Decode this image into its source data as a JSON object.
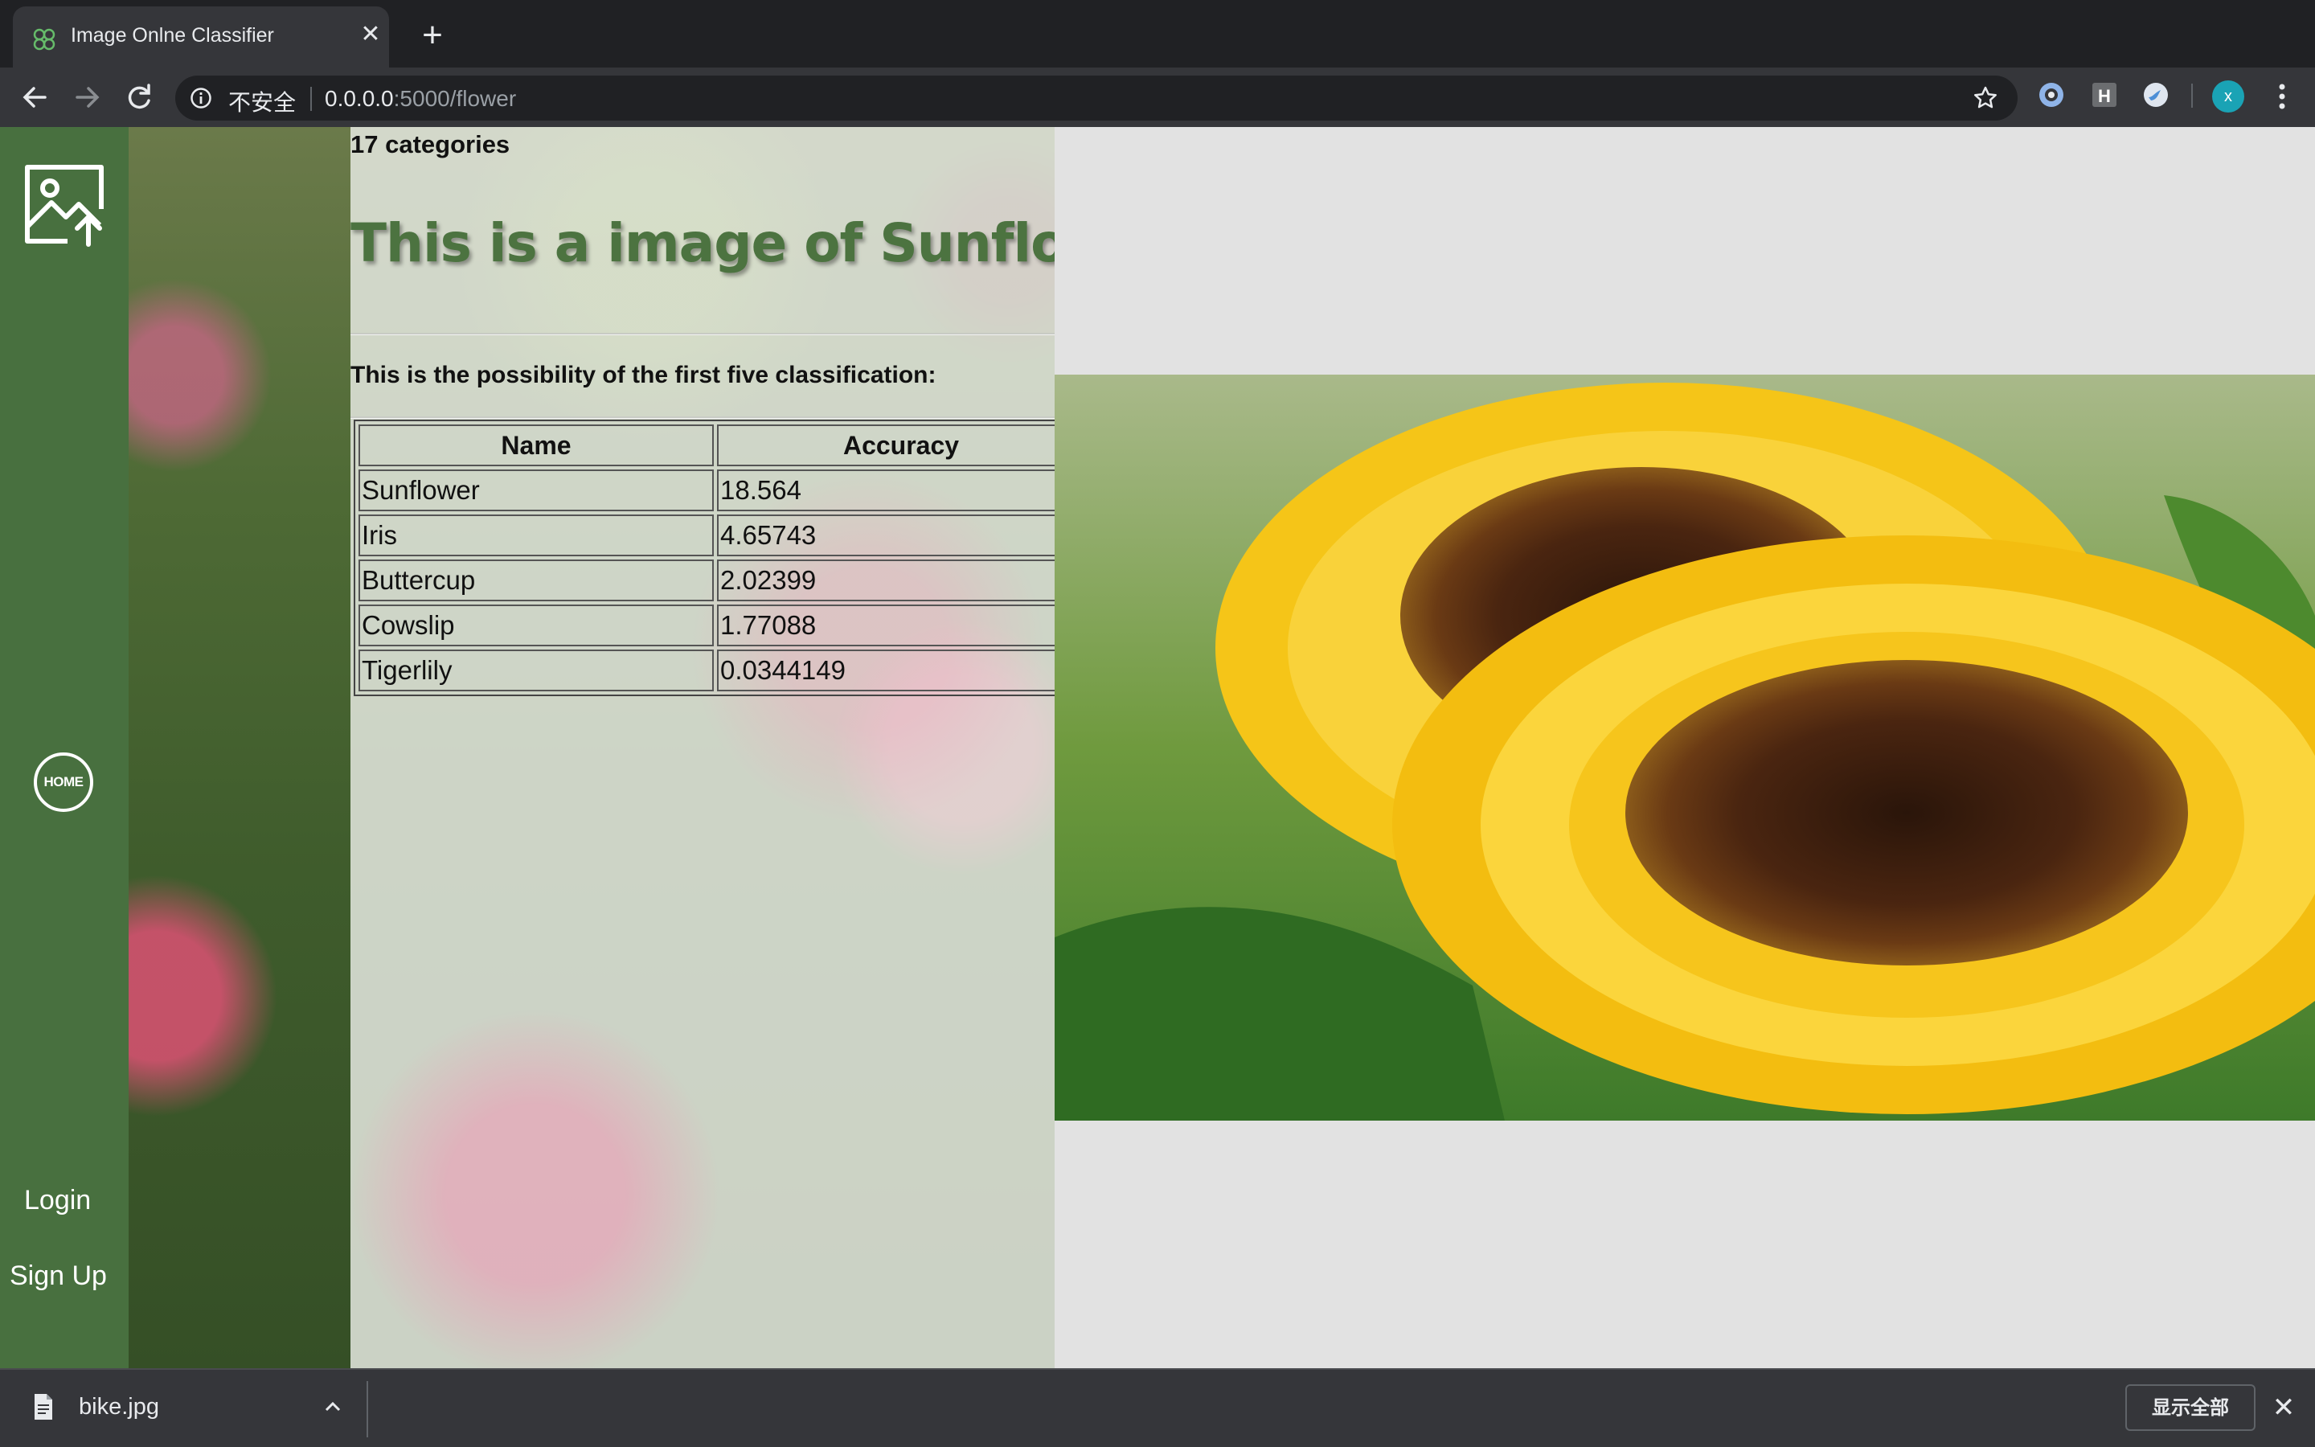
{
  "browser": {
    "tab": {
      "title": "Image Onlne Classifier",
      "favicon": "clover-icon",
      "close": "✕"
    },
    "new_tab": "+",
    "address": {
      "security_label": "不安全",
      "host": "0.0.0.0",
      "path": ":5000/flower"
    },
    "extensions": [
      "circle-extension-icon",
      "h-extension-icon",
      "bird-extension-icon"
    ],
    "profile_initial": "x"
  },
  "sidebar": {
    "upload_icon": "image-upload-icon",
    "home_label": "HOME",
    "login_label": "Login",
    "signup_label": "Sign Up"
  },
  "main": {
    "categories": "17 categories",
    "title": "This is a image of Sunflower",
    "subtitle": "This is the possibility of the first five classification:",
    "table": {
      "headers": [
        "Name",
        "Accuracy"
      ],
      "rows": [
        [
          "Sunflower",
          "18.564"
        ],
        [
          "Iris",
          "4.65743"
        ],
        [
          "Buttercup",
          "2.02399"
        ],
        [
          "Cowslip",
          "1.77088"
        ],
        [
          "Tigerlily",
          "0.0344149"
        ]
      ]
    },
    "preview": "sunflower-image"
  },
  "download_bar": {
    "file_name": "bike.jpg",
    "show_all": "显示全部",
    "close": "✕"
  },
  "colors": {
    "sidebar": "#48703f",
    "title": "#4c7340",
    "chrome_dark": "#202124",
    "chrome_toolbar": "#35363a"
  }
}
